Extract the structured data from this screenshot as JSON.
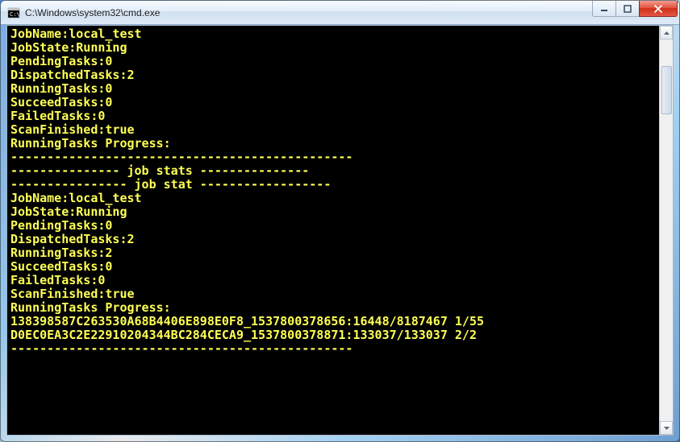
{
  "window": {
    "title": "C:\\Windows\\system32\\cmd.exe"
  },
  "terminal": {
    "lines": [
      "JobName:local_test",
      "JobState:Running",
      "PendingTasks:0",
      "DispatchedTasks:2",
      "RunningTasks:0",
      "SucceedTasks:0",
      "FailedTasks:0",
      "ScanFinished:true",
      "RunningTasks Progress:",
      "-----------------------------------------------",
      "--------------- job stats ---------------",
      "---------------- job stat ------------------",
      "JobName:local_test",
      "JobState:Running",
      "PendingTasks:0",
      "DispatchedTasks:2",
      "RunningTasks:2",
      "SucceedTasks:0",
      "FailedTasks:0",
      "ScanFinished:true",
      "RunningTasks Progress:",
      "138398587C263530A68B4406E898E0F8_1537800378656:16448/8187467 1/55",
      "D0EC0EA3C2E22910204344BC284CECA9_1537800378871:133037/133037 2/2",
      "-----------------------------------------------"
    ]
  }
}
